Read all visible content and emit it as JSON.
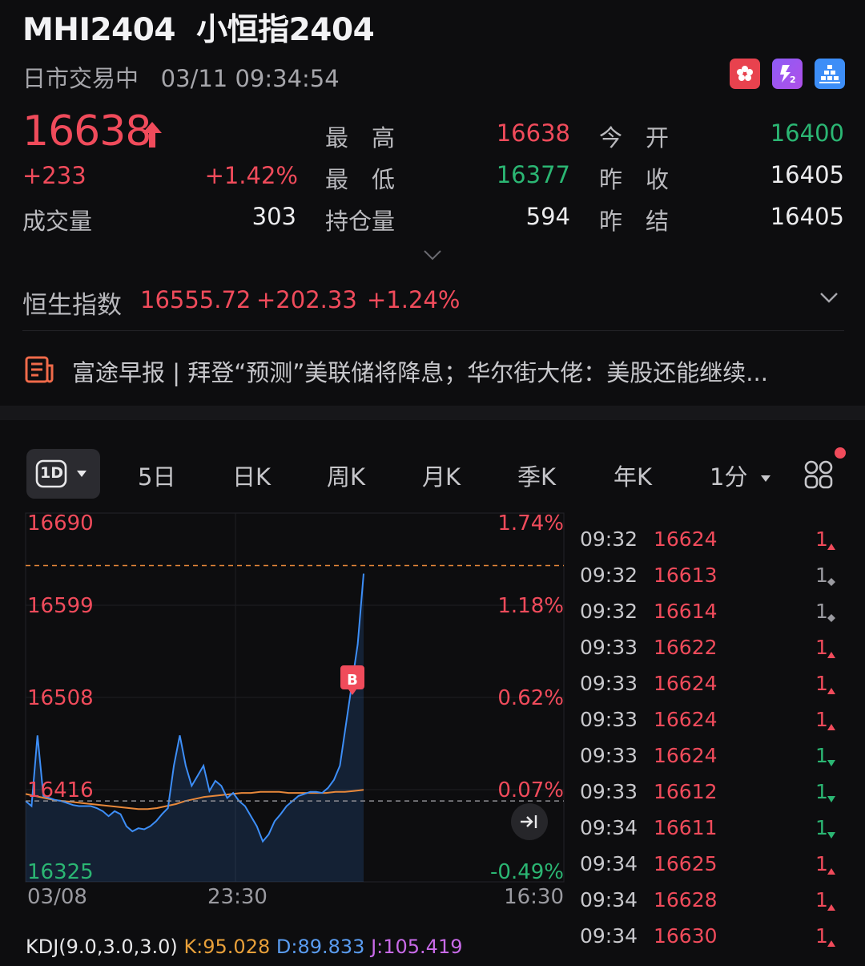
{
  "header": {
    "code": "MHI2404",
    "name": "小恒指2404",
    "status": "日市交易中",
    "datetime": "03/11 09:34:54",
    "badges": [
      "hk-flag-icon",
      "lv2-icon",
      "pyramid-icon"
    ]
  },
  "quote": {
    "price": "16638",
    "change": "+233",
    "change_pct": "+1.42%",
    "volume_label": "成交量",
    "volume": "303",
    "high_label": "最　高",
    "high": "16638",
    "low_label": "最　低",
    "low": "16377",
    "oi_label": "持仓量",
    "oi": "594",
    "open_label": "今　开",
    "open": "16400",
    "prev_close_label": "昨　收",
    "prev_close": "16405",
    "prev_settle_label": "昨　结",
    "prev_settle": "16405"
  },
  "index": {
    "name": "恒生指数",
    "value": "16555.72",
    "change": "+202.33",
    "change_pct": "+1.24%"
  },
  "news": {
    "text": "富途早报 | 拜登“预测”美联储将降息；华尔街大佬：美股还能继续..."
  },
  "tabs": {
    "t1d": "1D",
    "t5d": "5日",
    "day": "日K",
    "week": "周K",
    "month": "月K",
    "quarter": "季K",
    "year": "年K",
    "interval": "1分"
  },
  "chart_axes": {
    "y_left": [
      "16690",
      "16599",
      "16508",
      "16416",
      "16325"
    ],
    "y_right": [
      "1.74%",
      "1.18%",
      "0.62%",
      "0.07%",
      "-0.49%"
    ],
    "x": [
      "03/08",
      "23:30",
      "16:30"
    ],
    "marker": "B"
  },
  "chart_data": {
    "type": "line",
    "ylim": [
      16325,
      16690
    ],
    "prev_close": 16405,
    "last": 16638,
    "series": [
      {
        "values": [
          16405,
          16400,
          16470,
          16410,
          16408,
          16406,
          16405,
          16403,
          16401,
          16400,
          16400,
          16400,
          16398,
          16395,
          16390,
          16395,
          16392,
          16380,
          16375,
          16378,
          16377,
          16380,
          16385,
          16392,
          16398,
          16440,
          16470,
          16440,
          16420,
          16430,
          16440,
          16415,
          16425,
          16420,
          16408,
          16413,
          16405,
          16400,
          16390,
          16380,
          16365,
          16372,
          16385,
          16392,
          16400,
          16405,
          16410,
          16412,
          16414,
          16414,
          16413,
          16418,
          16426,
          16440,
          16480,
          16520,
          16560,
          16630
        ]
      },
      {
        "values": [
          16412,
          16410,
          16408,
          16406,
          16405,
          16404,
          16403,
          16402,
          16401,
          16400,
          16399,
          16398,
          16397,
          16397,
          16398,
          16400,
          16402,
          16405,
          16407,
          16409,
          16410,
          16411,
          16412,
          16413,
          16413,
          16414,
          16414,
          16414,
          16413,
          16413,
          16413,
          16413,
          16413,
          16414,
          16414,
          16415,
          16416
        ]
      }
    ]
  },
  "ticks": [
    {
      "time": "09:32",
      "price": "16624",
      "vol": "1",
      "dir": "up"
    },
    {
      "time": "09:32",
      "price": "16613",
      "vol": "1",
      "dir": "neutral"
    },
    {
      "time": "09:32",
      "price": "16614",
      "vol": "1",
      "dir": "neutral"
    },
    {
      "time": "09:33",
      "price": "16622",
      "vol": "1",
      "dir": "up"
    },
    {
      "time": "09:33",
      "price": "16624",
      "vol": "1",
      "dir": "up"
    },
    {
      "time": "09:33",
      "price": "16624",
      "vol": "1",
      "dir": "up"
    },
    {
      "time": "09:33",
      "price": "16624",
      "vol": "1",
      "dir": "down"
    },
    {
      "time": "09:33",
      "price": "16612",
      "vol": "1",
      "dir": "down"
    },
    {
      "time": "09:34",
      "price": "16611",
      "vol": "1",
      "dir": "down"
    },
    {
      "time": "09:34",
      "price": "16625",
      "vol": "1",
      "dir": "up"
    },
    {
      "time": "09:34",
      "price": "16628",
      "vol": "1",
      "dir": "up"
    },
    {
      "time": "09:34",
      "price": "16630",
      "vol": "1",
      "dir": "up"
    }
  ],
  "kdj": {
    "label": "KDJ(9.0,3.0,3.0)",
    "k": "K:95.028",
    "d": "D:89.833",
    "j": "J:105.419"
  },
  "colors": {
    "up": "#f04b5b",
    "down": "#2bb673",
    "line": "#3d8ef7",
    "avg": "#e8883a"
  }
}
